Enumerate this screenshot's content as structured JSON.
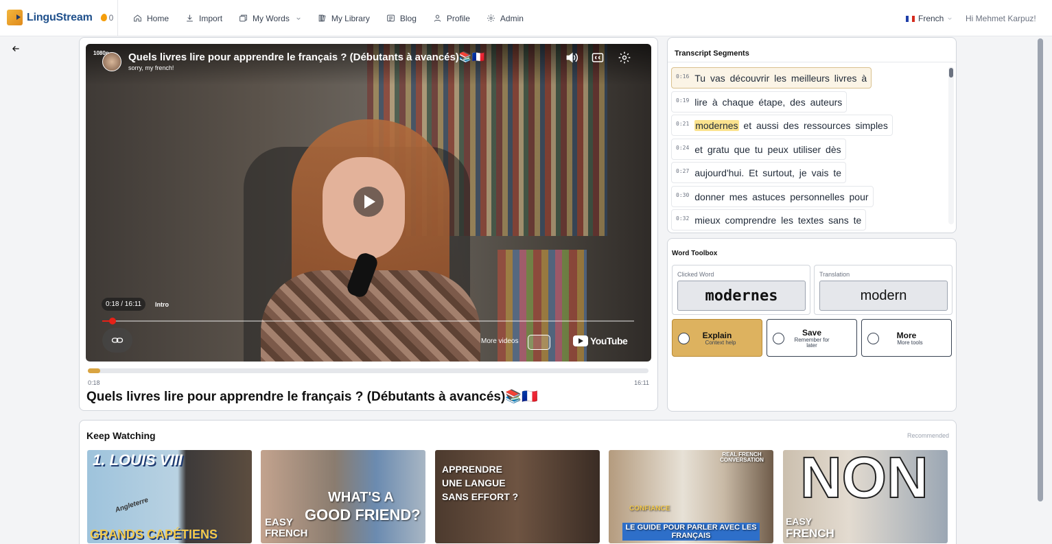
{
  "app": {
    "name": "LinguStream",
    "streak": "0",
    "nav": [
      {
        "label": "Home",
        "icon": "home-icon"
      },
      {
        "label": "Import",
        "icon": "download-icon"
      },
      {
        "label": "My Words",
        "icon": "cards-icon"
      },
      {
        "label": "My Library",
        "icon": "library-icon"
      },
      {
        "label": "Blog",
        "icon": "blog-icon"
      },
      {
        "label": "Profile",
        "icon": "user-icon"
      },
      {
        "label": "Admin",
        "icon": "gear-icon"
      }
    ],
    "language": "French",
    "greeting": "Hi Mehmet Karpuz!"
  },
  "player": {
    "resolution": "1080p",
    "title": "Quels livres lire pour apprendre le français ? (Débutants à avancés)📚🇫🇷",
    "channel_subtitle": "sorry, my french!",
    "time_display": "0:18 / 16:11",
    "chapter": "Intro",
    "played_fraction": 0.019,
    "more_videos": "More videos",
    "youtube_label": "YouTube"
  },
  "video": {
    "current_time": "0:18",
    "duration": "16:11",
    "title": "Quels livres lire pour apprendre le français ? (Débutants à avancés)📚🇫🇷"
  },
  "transcript": {
    "title": "Transcript Segments",
    "segments": [
      {
        "time": "0:16",
        "text": "Tu vas découvrir les meilleurs livres à",
        "active": true
      },
      {
        "time": "0:19",
        "text": "lire à chaque étape, des auteurs"
      },
      {
        "time": "0:21",
        "pre": "",
        "highlight": "modernes",
        "post": " et aussi des ressources simples"
      },
      {
        "time": "0:24",
        "text": "et gratu que tu peux utiliser dès"
      },
      {
        "time": "0:27",
        "text": "aujourd'hui. Et surtout, je vais te"
      },
      {
        "time": "0:30",
        "text": "donner mes astuces personnelles pour"
      },
      {
        "time": "0:32",
        "text": "mieux comprendre les textes sans te"
      }
    ]
  },
  "toolbox": {
    "title": "Word Toolbox",
    "clicked_label": "Clicked Word",
    "clicked_word": "modernes",
    "translation_label": "Translation",
    "translation": "modern",
    "actions": [
      {
        "label": "Explain",
        "sub": "Context help"
      },
      {
        "label": "Save",
        "sub": "Remember for later"
      },
      {
        "label": "More",
        "sub": "More tools"
      }
    ]
  },
  "keep_watching": {
    "title": "Keep Watching",
    "tag": "Recommended",
    "videos": [
      {
        "top": "1. LOUIS VIII",
        "bottom": "GRANDS CAPÉTIENS",
        "extra": "Angleterre"
      },
      {
        "top": "WHAT'S A",
        "bottom": "GOOD FRIEND?",
        "extra": "EASY FRENCH"
      },
      {
        "top": "APPRENDRE",
        "bottom": "UNE LANGUE",
        "extra": "SANS EFFORT ?"
      },
      {
        "top": "REAL FRENCH CONVERSATION",
        "bottom": "LE GUIDE POUR PARLER AVEC LES FRANÇAIS",
        "extra": "CONFIANCE"
      },
      {
        "top": "NON",
        "bottom": "FRENCH",
        "extra": "EASY"
      }
    ]
  },
  "colors": {
    "accent": "#ddb25f",
    "brand": "#1e4f8b",
    "highlight": "#fbe38e"
  }
}
